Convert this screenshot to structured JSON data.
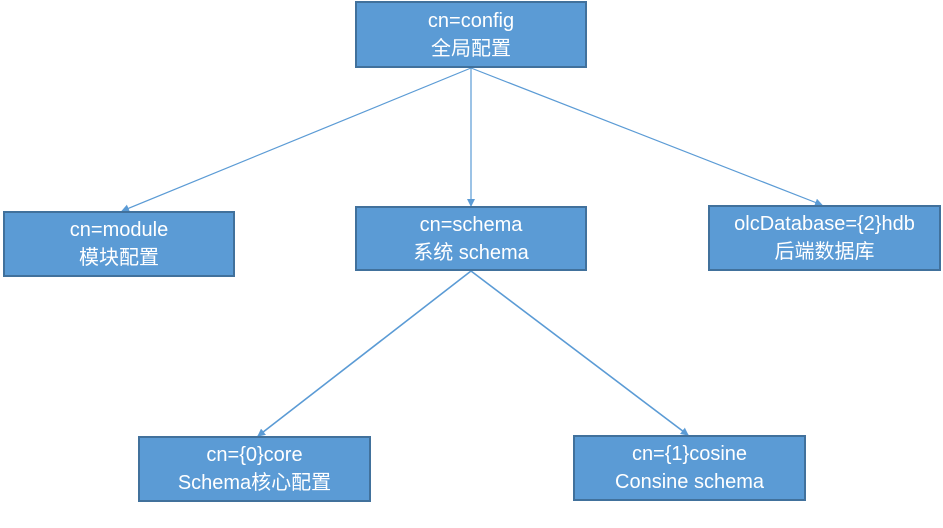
{
  "colors": {
    "fill": "#5b9bd5",
    "border": "#41719c",
    "line": "#5b9bd5"
  },
  "nodes": {
    "config": {
      "line1": "cn=config",
      "line2": "全局配置"
    },
    "module": {
      "line1": "cn=module",
      "line2": "模块配置"
    },
    "schema": {
      "line1": "cn=schema",
      "line2": "系统 schema"
    },
    "database": {
      "line1": "olcDatabase={2}hdb",
      "line2": "后端数据库"
    },
    "core": {
      "line1": "cn={0}core",
      "line2": "Schema核心配置"
    },
    "cosine": {
      "line1": "cn={1}cosine",
      "line2": "Consine schema"
    }
  }
}
